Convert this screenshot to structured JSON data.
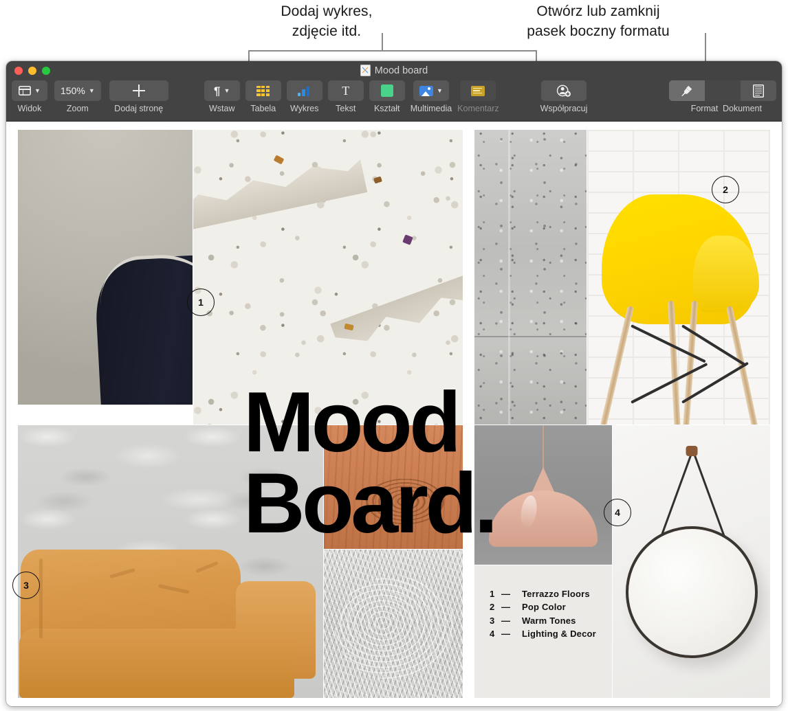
{
  "annotations": {
    "callout_left": "Dodaj wykres,\nzdjęcie itd.",
    "callout_right": "Otwórz lub zamknij\npasek boczny formatu"
  },
  "window": {
    "title": "Mood board",
    "doc_icon": "keynote-document-icon",
    "traffic_lights": [
      "close",
      "minimize",
      "zoom"
    ]
  },
  "toolbar": {
    "items": [
      {
        "id": "view",
        "label": "Widok",
        "icon": "sidebar-layout-icon",
        "has_chevron": true,
        "dimmed": false
      },
      {
        "id": "zoom",
        "label": "Zoom",
        "value": "150%",
        "has_chevron": true,
        "dimmed": false
      },
      {
        "id": "add_page",
        "label": "Dodaj stronę",
        "icon": "plus-icon",
        "has_chevron": false,
        "dimmed": false
      },
      {
        "id": "insert",
        "label": "Wstaw",
        "icon": "paragraph-icon",
        "has_chevron": true,
        "dimmed": false
      },
      {
        "id": "table",
        "label": "Tabela",
        "icon": "table-grid-icon",
        "has_chevron": false,
        "dimmed": false
      },
      {
        "id": "chart",
        "label": "Wykres",
        "icon": "bar-chart-icon",
        "has_chevron": false,
        "dimmed": false
      },
      {
        "id": "text",
        "label": "Tekst",
        "icon": "text-t-icon",
        "has_chevron": false,
        "dimmed": false
      },
      {
        "id": "shape",
        "label": "Kształt",
        "icon": "shape-square-icon",
        "has_chevron": false,
        "dimmed": false
      },
      {
        "id": "media",
        "label": "Multimedia",
        "icon": "photo-icon",
        "has_chevron": true,
        "dimmed": false
      },
      {
        "id": "comment",
        "label": "Komentarz",
        "icon": "comment-note-icon",
        "has_chevron": false,
        "dimmed": true
      },
      {
        "id": "collaborate",
        "label": "Współpracuj",
        "icon": "add-person-icon",
        "has_chevron": false,
        "dimmed": false
      }
    ],
    "segment": {
      "format": {
        "label": "Format",
        "icon": "format-brush-icon",
        "active": true
      },
      "document": {
        "label": "Dokument",
        "icon": "document-lines-icon",
        "active": false
      }
    },
    "zoom_value": "150%",
    "accent_colors": {
      "table_yellow": "#f5c432",
      "chart_blue": "#3f9fe8",
      "shape_green": "#49d38a",
      "media_blue": "#3f86e0",
      "comment_gold": "#c9a227"
    }
  },
  "document": {
    "title_lines": [
      "Mood",
      "Board."
    ],
    "badges": [
      {
        "number": "1"
      },
      {
        "number": "2"
      },
      {
        "number": "3"
      },
      {
        "number": "4"
      }
    ],
    "legend": [
      {
        "number": "1",
        "dash": "—",
        "label": "Terrazzo Floors"
      },
      {
        "number": "2",
        "dash": "—",
        "label": "Pop Color"
      },
      {
        "number": "3",
        "dash": "—",
        "label": "Warm Tones"
      },
      {
        "number": "4",
        "dash": "—",
        "label": "Lighting & Decor"
      }
    ],
    "images": [
      {
        "id": "chair-dark",
        "alt": "dark-leather-armchair-photo"
      },
      {
        "id": "terrazzo",
        "alt": "terrazzo-stone-texture-photo"
      },
      {
        "id": "concrete",
        "alt": "concrete-wall-texture-photo"
      },
      {
        "id": "yellow-chair",
        "alt": "yellow-eames-chair-photo"
      },
      {
        "id": "plaster-sofa",
        "alt": "tan-leather-sofa-photo"
      },
      {
        "id": "wood",
        "alt": "wood-grain-texture-photo"
      },
      {
        "id": "fur",
        "alt": "grey-fur-rug-texture-photo"
      },
      {
        "id": "lamp",
        "alt": "pink-pendant-lamp-photo"
      },
      {
        "id": "mirror",
        "alt": "round-hanging-mirror-photo"
      }
    ]
  }
}
